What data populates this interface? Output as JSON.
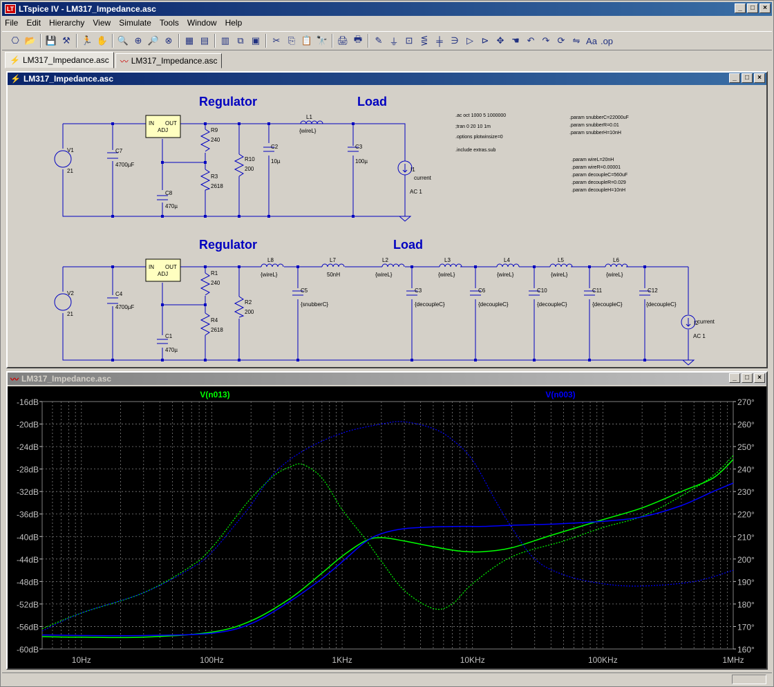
{
  "app": {
    "title": "LTspice IV - LM317_Impedance.asc",
    "logo_text": "LT"
  },
  "menu": [
    "File",
    "Edit",
    "Hierarchy",
    "View",
    "Simulate",
    "Tools",
    "Window",
    "Help"
  ],
  "toolbar_icons": [
    "new-schematic-icon",
    "open-icon",
    "save-icon",
    "control-panel-icon",
    "run-icon",
    "halt-icon",
    "zoom-in-icon",
    "zoom-pan-icon",
    "zoom-out-icon",
    "zoom-fit-icon",
    "autorange-icon",
    "pick-visible-icon",
    "tile-icon",
    "cascade-icon",
    "close-windows-icon",
    "cut-icon",
    "copy-icon",
    "paste-icon",
    "find-icon",
    "print-setup-icon",
    "print-icon",
    "wire-icon",
    "ground-icon",
    "label-net-icon",
    "resistor-icon",
    "capacitor-icon",
    "inductor-icon",
    "diode-icon",
    "component-icon",
    "move-icon",
    "drag-icon",
    "undo-icon",
    "redo-icon",
    "rotate-icon",
    "mirror-icon",
    "text-icon",
    "spice-directive-icon"
  ],
  "toolbar_glyphs": [
    "⎔",
    "📂",
    "💾",
    "⚒",
    "🏃",
    "✋",
    "🔍",
    "⊕",
    "🔎",
    "⊗",
    "▦",
    "▤",
    "▥",
    "⧉",
    "▣",
    "✂",
    "⎘",
    "📋",
    "🔭",
    "🖨",
    "🖶",
    "✎",
    "⏚",
    "⊡",
    "⋚",
    "╪",
    "∋",
    "▷",
    "⊳",
    "✥",
    "☚",
    "↶",
    "↷",
    "⟳",
    "⇋",
    "Aa",
    ".op"
  ],
  "tabs": [
    {
      "label": "LM317_Impedance.asc",
      "active": true
    },
    {
      "label": "LM317_Impedance.asc",
      "active": false
    }
  ],
  "schematic_window": {
    "title": "LM317_Impedance.asc",
    "headings": {
      "reg1": "Regulator",
      "load1": "Load",
      "reg2": "Regulator",
      "load2": "Load"
    },
    "c1": {
      "V1": "V1",
      "V1v": "21",
      "C7": "C7",
      "C7v": "4700µF",
      "u_in": "IN",
      "u_out": "OUT",
      "u_adj": "ADJ",
      "R9": "R9",
      "R9v": "240",
      "R3": "R3",
      "R3v": "2618",
      "C8": "C8",
      "C8v": "470µ",
      "R10": "R10",
      "R10v": "200",
      "C2": "C2",
      "C2v": "10µ",
      "L1": "L1",
      "L1v": "{wireL}",
      "C3": "C3",
      "C3v": "100µ",
      "I1": "I1",
      "I1v": "current",
      "I1ac": "AC 1"
    },
    "c2": {
      "V2": "V2",
      "V2v": "21",
      "C4": "C4",
      "C4v": "4700µF",
      "u_in": "IN",
      "u_out": "OUT",
      "u_adj": "ADJ",
      "R1": "R1",
      "R1v": "240",
      "R4": "R4",
      "R4v": "2618",
      "C1": "C1",
      "C1v": "470µ",
      "R2": "R2",
      "R2v": "200",
      "L8": "L8",
      "L8v": "{wireL}",
      "C5": "C5",
      "C5v": "{snubberC}",
      "L7": "L7",
      "L7v": "50nH",
      "L2": "L2",
      "L2v": "{wireL}",
      "C3b": "C3",
      "C3bv": "{decoupleC}",
      "L3": "L3",
      "L3v": "{wireL}",
      "C6": "C6",
      "C6v": "{decoupleC}",
      "L4": "L4",
      "L4v": "{wireL}",
      "C10": "C10",
      "C10v": "{decoupleC}",
      "L5": "L5",
      "L5v": "{wireL}",
      "C11": "C11",
      "C11v": "{decoupleC}",
      "L6": "L6",
      "L6v": "{wireL}",
      "C12": "C12",
      "C12v": "{decoupleC}",
      "I2": "I2",
      "I2v": "current",
      "I2ac": "AC 1"
    },
    "directives": {
      "d1": ".ac oct 1000 5 1000000",
      "d2": ";tran 0 20 10 1m",
      "d3": ".options plotwinsize=0",
      "d4": ".include extras.sub",
      "p1": ".param snubberC=22000uF",
      "p2": ".param snubberR=0.01",
      "p3": ".param snubberH=10nH",
      "p4": ".param wireL=20nH",
      "p5": ".param wireR=0.00001",
      "p6": ".param decoupleC=560uF",
      "p7": ".param decoupleR=0.029",
      "p8": ".param decoupleH=10nH"
    }
  },
  "waveform_window": {
    "title": "LM317_Impedance.asc"
  },
  "chart_data": {
    "type": "line",
    "xscale": "log",
    "xlim": [
      5,
      1000000
    ],
    "ylim_left_db": [
      -60,
      -16
    ],
    "ylim_right_deg": [
      160,
      270
    ],
    "grid": true,
    "x_tick_labels": [
      "10Hz",
      "100Hz",
      "1KHz",
      "10KHz",
      "100KHz",
      "1MHz"
    ],
    "x_ticks": [
      10,
      100,
      1000,
      10000,
      100000,
      1000000
    ],
    "y_left_tick_labels": [
      "-16dB",
      "-20dB",
      "-24dB",
      "-28dB",
      "-32dB",
      "-36dB",
      "-40dB",
      "-44dB",
      "-48dB",
      "-52dB",
      "-56dB",
      "-60dB"
    ],
    "y_left_ticks": [
      -16,
      -20,
      -24,
      -28,
      -32,
      -36,
      -40,
      -44,
      -48,
      -52,
      -56,
      -60
    ],
    "y_right_tick_labels": [
      "270°",
      "260°",
      "250°",
      "240°",
      "230°",
      "220°",
      "210°",
      "200°",
      "190°",
      "180°",
      "170°",
      "160°"
    ],
    "y_right_ticks": [
      270,
      260,
      250,
      240,
      230,
      220,
      210,
      200,
      190,
      180,
      170,
      160
    ],
    "series": [
      {
        "name": "V(n013)",
        "color": "#00ff00",
        "magnitude_db": {
          "x": [
            5,
            10,
            30,
            100,
            200,
            400,
            700,
            1000,
            1500,
            2000,
            3000,
            5000,
            8000,
            12000,
            20000,
            40000,
            100000,
            200000,
            400000,
            700000,
            1000000
          ],
          "y": [
            -57.8,
            -57.9,
            -57.9,
            -57,
            -55,
            -51,
            -46.5,
            -43.5,
            -40.8,
            -40.2,
            -40.8,
            -41.8,
            -42.6,
            -42.7,
            -42,
            -39.8,
            -37,
            -34.9,
            -32,
            -29.6,
            -26.3
          ]
        },
        "phase_deg": {
          "x": [
            5,
            10,
            30,
            70,
            100,
            150,
            200,
            300,
            400,
            500,
            700,
            1000,
            1500,
            2000,
            3000,
            5000,
            7000,
            10000,
            20000,
            50000,
            100000,
            200000,
            400000,
            700000,
            1000000
          ],
          "y": [
            169,
            176,
            185,
            197,
            205,
            218,
            227,
            237,
            241,
            242,
            236,
            222,
            209,
            199,
            186,
            178,
            180,
            189,
            201,
            208,
            214,
            219,
            228,
            237,
            246
          ]
        }
      },
      {
        "name": "V(n003)",
        "color": "#0000ff",
        "magnitude_db": {
          "x": [
            5,
            10,
            30,
            100,
            200,
            400,
            700,
            1000,
            1500,
            2000,
            3000,
            5000,
            8000,
            12000,
            20000,
            40000,
            100000,
            200000,
            400000,
            700000,
            1000000
          ],
          "y": [
            -57.5,
            -57.6,
            -57.6,
            -57.2,
            -55.5,
            -51.5,
            -47.5,
            -44.5,
            -41,
            -39.5,
            -38.6,
            -38.3,
            -38.2,
            -38.2,
            -38,
            -37.8,
            -37.3,
            -36.5,
            -34.5,
            -32,
            -30.5
          ]
        },
        "phase_deg": {
          "x": [
            5,
            10,
            30,
            70,
            100,
            150,
            200,
            300,
            500,
            1000,
            2000,
            3000,
            5000,
            7000,
            10000,
            15000,
            20000,
            30000,
            50000,
            100000,
            200000,
            500000,
            1000000
          ],
          "y": [
            168,
            176,
            185,
            196,
            203,
            215,
            224,
            238,
            248,
            256,
            260,
            261,
            258,
            253,
            244,
            226,
            214,
            200,
            193,
            189,
            188,
            190,
            195
          ]
        }
      }
    ]
  }
}
